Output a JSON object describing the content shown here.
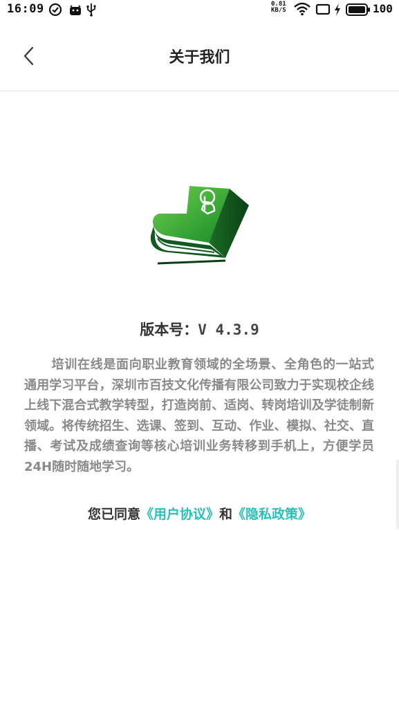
{
  "status_bar": {
    "time": "16:09",
    "net_speed_value": "0.81",
    "net_speed_unit": "KB/S",
    "battery": "100"
  },
  "header": {
    "title": "关于我们"
  },
  "about": {
    "version_label": "版本号：",
    "version_value": "V 4.3.9",
    "description": "培训在线是面向职业教育领域的全场景、全角色的一站式通用学习平台，深圳市百技文化传播有限公司致力于实现校企线上线下混合式教学转型，打造岗前、适岗、转岗培训及学徒制新领域。将传统招生、选课、签到、互动、作业、模拟、社交、直播、考试及成绩查询等核心培训业务转移到手机上，方便学员24H随时随地学习。"
  },
  "agreement": {
    "prefix": "您已同意",
    "user_agreement": "《用户协议》",
    "joiner": "和",
    "privacy_policy": "《隐私政策》"
  },
  "colors": {
    "link": "#27c1b9",
    "logo_green": "#1e8f2e",
    "logo_dark": "#0b4d1c"
  }
}
